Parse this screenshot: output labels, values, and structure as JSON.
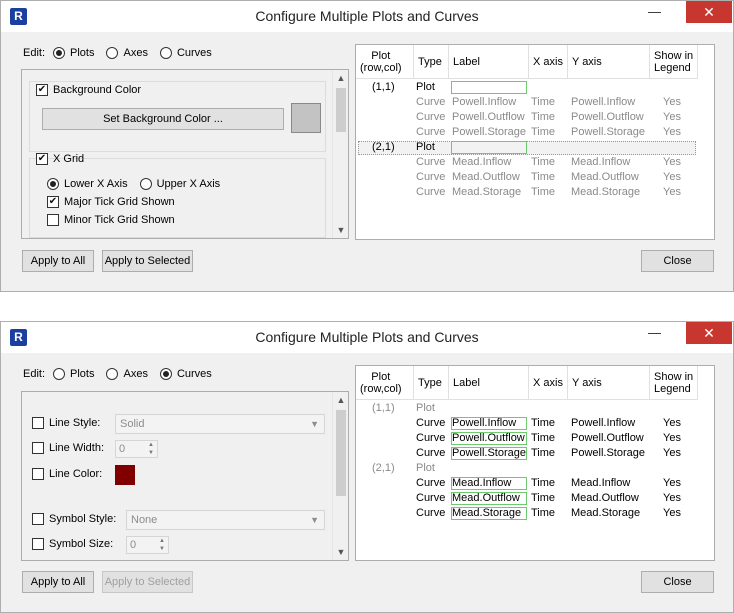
{
  "window_title": "Configure Multiple Plots and Curves",
  "app_icon_letter": "R",
  "titlebar": {
    "minimize": "—",
    "maximize": "☐",
    "close": "✕"
  },
  "edit_label": "Edit:",
  "edit_options": [
    "Plots",
    "Axes",
    "Curves"
  ],
  "table_headers": {
    "plot": "Plot\n(row,col)",
    "type": "Type",
    "label": "Label",
    "xaxis": "X axis",
    "yaxis": "Y axis",
    "legend": "Show in\nLegend"
  },
  "buttons": {
    "apply_all": "Apply to All",
    "apply_selected": "Apply to Selected",
    "close": "Close"
  },
  "w1": {
    "selected_edit": "Plots",
    "background_color_label": "Background Color",
    "set_background_button": "Set Background Color ...",
    "x_grid_label": "X Grid",
    "lower_x_axis": "Lower X Axis",
    "upper_x_axis": "Upper X Axis",
    "major_tick": "Major Tick Grid Shown",
    "minor_tick": "Minor Tick Grid Shown",
    "swatch_color": "#c3c3c3"
  },
  "w2": {
    "selected_edit": "Curves",
    "line_style_label": "Line Style:",
    "line_style_value": "Solid",
    "line_width_label": "Line Width:",
    "line_width_value": "0",
    "line_color_label": "Line Color:",
    "line_color": "#800000",
    "symbol_style_label": "Symbol Style:",
    "symbol_style_value": "None",
    "symbol_size_label": "Symbol Size:",
    "symbol_size_value": "0"
  },
  "rows": [
    {
      "plot": "(1,1)",
      "type": "Plot",
      "label": "",
      "x": "",
      "y": "",
      "legend": ""
    },
    {
      "plot": "",
      "type": "Curve",
      "label": "Powell.Inflow",
      "x": "Time",
      "y": "Powell.Inflow",
      "legend": "Yes"
    },
    {
      "plot": "",
      "type": "Curve",
      "label": "Powell.Outflow",
      "x": "Time",
      "y": "Powell.Outflow",
      "legend": "Yes"
    },
    {
      "plot": "",
      "type": "Curve",
      "label": "Powell.Storage",
      "x": "Time",
      "y": "Powell.Storage",
      "legend": "Yes"
    },
    {
      "plot": "(2,1)",
      "type": "Plot",
      "label": "",
      "x": "",
      "y": "",
      "legend": ""
    },
    {
      "plot": "",
      "type": "Curve",
      "label": "Mead.Inflow",
      "x": "Time",
      "y": "Mead.Inflow",
      "legend": "Yes"
    },
    {
      "plot": "",
      "type": "Curve",
      "label": "Mead.Outflow",
      "x": "Time",
      "y": "Mead.Outflow",
      "legend": "Yes"
    },
    {
      "plot": "",
      "type": "Curve",
      "label": "Mead.Storage",
      "x": "Time",
      "y": "Mead.Storage",
      "legend": "Yes"
    }
  ]
}
